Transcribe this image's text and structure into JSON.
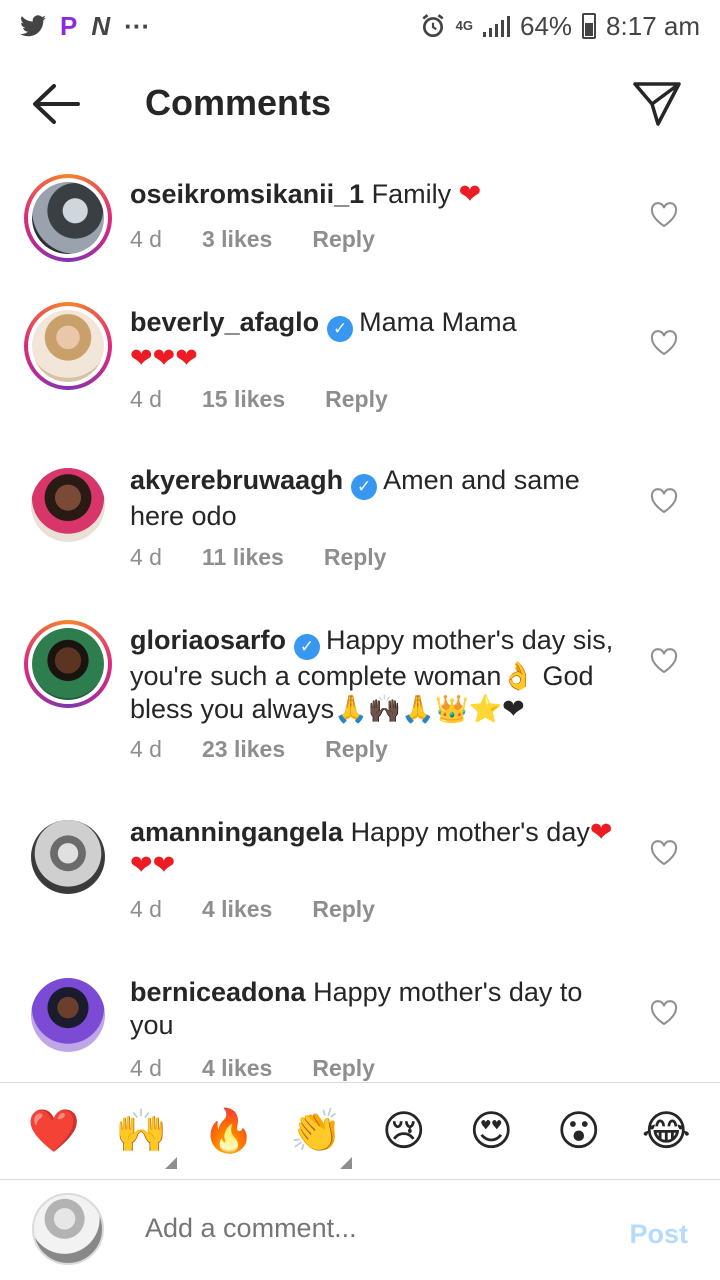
{
  "status": {
    "app_icons": [
      "twitter-icon",
      "p-app-icon",
      "n-app-icon"
    ],
    "more": "···",
    "network": "4G",
    "battery": "64%",
    "time": "8:17 am"
  },
  "header": {
    "title": "Comments"
  },
  "comments": [
    {
      "user": "oseikromsikanii_1",
      "verified": false,
      "text": "Family",
      "hearts": "❤",
      "age": "4 d",
      "likes": "3 likes",
      "reply": "Reply"
    },
    {
      "user": "beverly_afaglo",
      "verified": true,
      "text": "Mama Mama",
      "hearts": "❤❤❤",
      "age": "4 d",
      "likes": "15 likes",
      "reply": "Reply"
    },
    {
      "user": "akyerebruwaagh",
      "verified": true,
      "text": "Amen and same here odo",
      "hearts": "",
      "age": "4 d",
      "likes": "11 likes",
      "reply": "Reply"
    },
    {
      "user": "gloriaosarfo",
      "verified": true,
      "text": "Happy mother's day sis, you're such a complete woman👌 God bless you always🙏🙌🏿🙏👑⭐❤",
      "hearts": "",
      "age": "4 d",
      "likes": "23 likes",
      "reply": "Reply"
    },
    {
      "user": "amanningangela",
      "verified": false,
      "text": "Happy mother's day",
      "hearts": "❤❤❤",
      "age": "4 d",
      "likes": "4 likes",
      "reply": "Reply"
    },
    {
      "user": "berniceadona",
      "verified": false,
      "text": "Happy mother's day to you",
      "hearts": "",
      "age": "4 d",
      "likes": "4 likes",
      "reply": "Reply"
    }
  ],
  "reactions": [
    "❤️",
    "🙌",
    "🔥",
    "👏",
    "😢",
    "😍",
    "😮",
    "😂"
  ],
  "composer": {
    "placeholder": "Add a comment...",
    "post": "Post"
  }
}
